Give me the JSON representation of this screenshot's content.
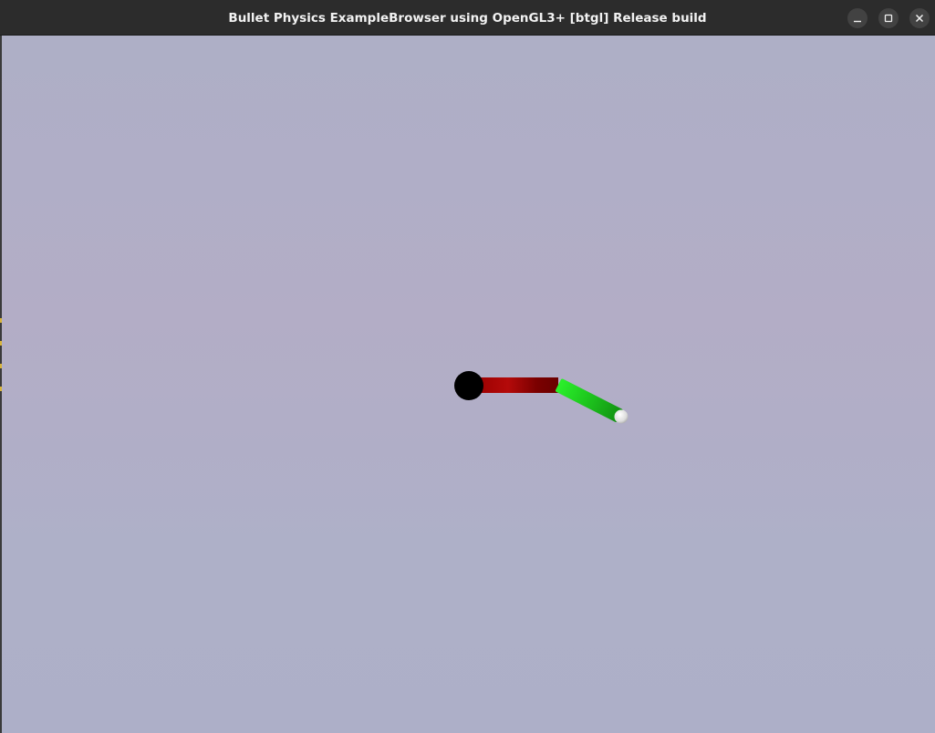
{
  "window": {
    "title": "Bullet Physics ExampleBrowser using OpenGL3+ [btgl] Release build",
    "controls": {
      "minimize": "minimize-icon",
      "maximize": "maximize-icon",
      "close": "close-icon"
    }
  },
  "scene": {
    "background_color": "#b0b0c8",
    "pivot_color": "#000000",
    "link1_color": "#a80000",
    "link2_color": "#22d022",
    "end_effector_color": "#e6e6e6"
  }
}
